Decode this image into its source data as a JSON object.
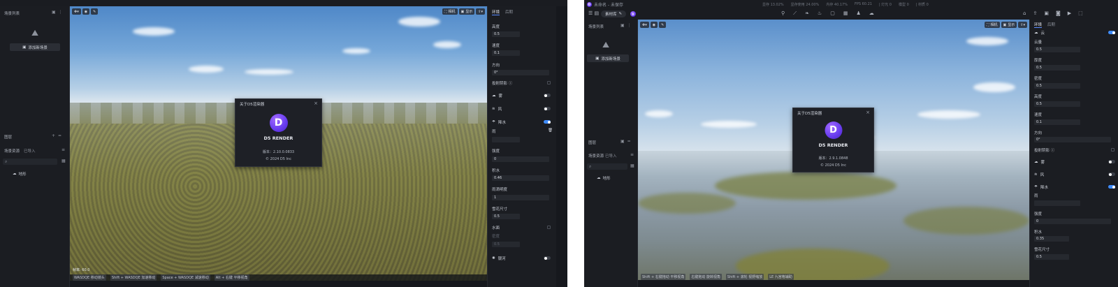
{
  "left": {
    "sidebar": {
      "scene_list_title": "场景列表",
      "add_scene_label": "添加新场景",
      "layers_title": "图层",
      "tab_scene_assets": "场景资源",
      "tab_imported": "已导入",
      "tree_item": "地形"
    },
    "viewport": {
      "camera_label": "相机",
      "display_label": "显示",
      "fps_text": "帧率: 60.0",
      "hints": [
        "WASDQE 移动镜头",
        "Shift + WASDQE 加速移动",
        "Space + WASDQE 减速移动",
        "Alt + 右键 平移视角"
      ]
    },
    "dialog": {
      "title": "关于D5渲染器",
      "brand": "D5 RENDER",
      "version_label": "版本：",
      "version": "2.10.0.0833",
      "copyright": "© 2024 D5 Inc"
    },
    "panel": {
      "tabs": [
        "环境",
        "后期"
      ],
      "rows": [
        {
          "label": "高度",
          "value": "0.5"
        },
        {
          "label": "速度",
          "value": "0.1"
        },
        {
          "label": "方向",
          "value": "0°"
        }
      ],
      "cast_shadow_label": "投射阴影",
      "fog_label": "雾",
      "wind_label": "风",
      "rain_label": "降水",
      "rain_type_label": "雨",
      "rows2": [
        {
          "label": "强度",
          "value": "0"
        },
        {
          "label": "积水",
          "value": "0.46"
        },
        {
          "label": "雨滴明度",
          "value": "1"
        },
        {
          "label": "雪花尺寸",
          "value": "0.5"
        }
      ],
      "puddle_label": "水面",
      "puddle_sub_label": "密度",
      "puddle_sub_value": "0.5",
      "galaxy_label": "银河"
    }
  },
  "right": {
    "topbar": {
      "file_title": "未命名 - 未保存",
      "project_button": "素材库",
      "stats": [
        "显存 13.02%",
        "显存使用 24.00%",
        "内存 40.17%",
        "FPS 60.21",
        "| 灯光 0",
        "模型 0",
        "| 材质 0"
      ]
    },
    "sidebar": {
      "scene_list_title": "场景列表",
      "add_scene_label": "添加新场景",
      "layers_title": "图层",
      "tab_scene_assets": "场景资源",
      "tab_imported": "已导入",
      "tree_item": "地形"
    },
    "viewport": {
      "camera_label": "相机",
      "display_label": "显示",
      "hints": [
        "Shift + 右键拖动 平移视角",
        "右键拖动 旋转视角",
        "Shift + 滚轮 视野缩放",
        "LE 九宫格辅助"
      ]
    },
    "dialog": {
      "title": "关于D5渲染器",
      "brand": "D5 RENDER",
      "version_label": "版本：",
      "version": "2.9.1.0848",
      "copyright": "© 2024 D5 Inc"
    },
    "panel": {
      "tabs": [
        "环境",
        "后期"
      ],
      "cloud_label": "云",
      "rows": [
        {
          "label": "云量",
          "value": "0.5"
        },
        {
          "label": "厚度",
          "value": "0.5"
        },
        {
          "label": "密度",
          "value": "0.5"
        },
        {
          "label": "高度",
          "value": "0.5"
        },
        {
          "label": "速度",
          "value": "0.1"
        },
        {
          "label": "方向",
          "value": "0°"
        }
      ],
      "cast_shadow_label": "投射阴影",
      "fog_label": "雾",
      "wind_label": "风",
      "rain_label": "降水",
      "rain_type_label": "雨",
      "rows2": [
        {
          "label": "强度",
          "value": "0"
        },
        {
          "label": "积水",
          "value": "0.35"
        },
        {
          "label": "雪花尺寸",
          "value": "0.5"
        }
      ]
    }
  },
  "colors": {
    "accent": "#3f8cff",
    "logo": "#6b3ff0",
    "bg": "#16181d"
  }
}
